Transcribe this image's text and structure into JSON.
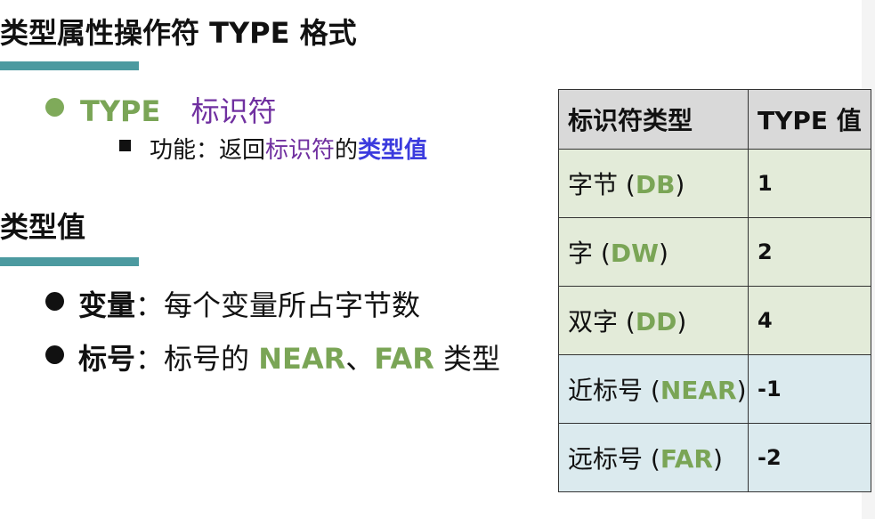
{
  "title": "类型属性操作符 TYPE 格式",
  "bullet1": {
    "keyword": "TYPE",
    "operand": "标识符",
    "sub": {
      "prefix": "功能：返回",
      "term": "标识符",
      "mid": "的",
      "result": "类型值"
    }
  },
  "section2": "类型值",
  "bullets2": [
    {
      "label": "变量",
      "sep": "：",
      "text": "每个变量所占字节数"
    },
    {
      "label": "标号",
      "sep": "：",
      "text_a": "标号的 ",
      "near": "NEAR",
      "dun": "、",
      "far": "FAR",
      "text_b": " 类型"
    }
  ],
  "table": {
    "headers": [
      "标识符类型",
      "TYPE 值"
    ],
    "rows": [
      {
        "name": "字节 (",
        "code": "DB",
        "close": ")",
        "value": "1"
      },
      {
        "name": "字 (",
        "code": "DW",
        "close": ")",
        "value": "2"
      },
      {
        "name": "双字 (",
        "code": "DD",
        "close": ")",
        "value": "4"
      },
      {
        "name": "近标号 (",
        "code": "NEAR",
        "close": ")",
        "value": "-1"
      },
      {
        "name": "远标号 (",
        "code": "FAR",
        "close": ")",
        "value": "-2"
      }
    ]
  },
  "colors": {
    "accent_bar": "#4c9aa0",
    "keyword_green": "#7aa556",
    "purple": "#7030a0",
    "blue": "#3b3bde",
    "row_green": "#e3ebd9",
    "row_blue": "#dbeaee",
    "header_gray": "#d9d9d9"
  }
}
